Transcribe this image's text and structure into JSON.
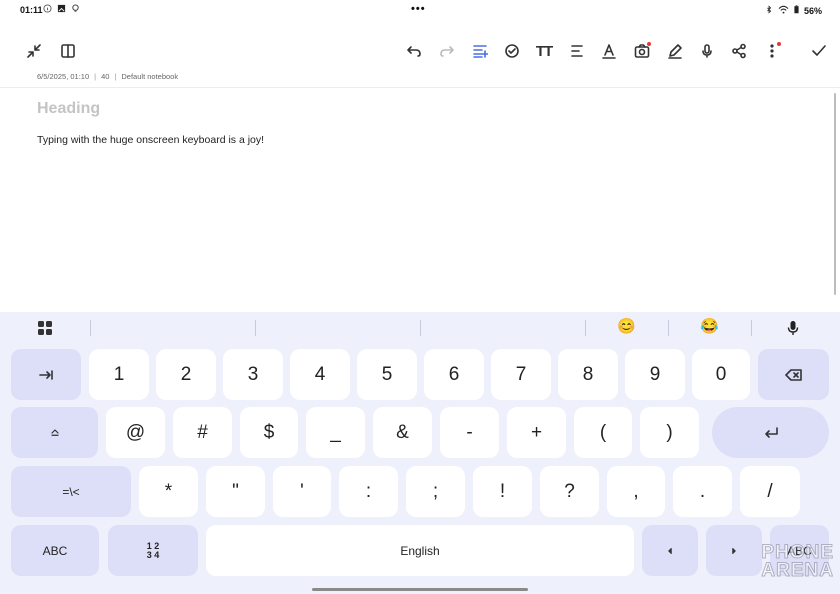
{
  "status_bar": {
    "time": "01:11",
    "left_icons": [
      "info-icon",
      "photo-icon",
      "bulb-icon"
    ],
    "center_dots": "•••",
    "right_icons": [
      "bluetooth-icon",
      "wifi-icon"
    ],
    "battery": "56%"
  },
  "toolbar": {
    "left": [
      "collapse-icon",
      "split-view-icon"
    ],
    "right": [
      "undo-icon",
      "redo-icon",
      "format-list-icon",
      "checkbox-icon",
      "text-size-icon",
      "align-icon",
      "text-color-icon",
      "camera-icon",
      "pen-icon",
      "voice-record-icon",
      "share-icon",
      "more-icon",
      "done-icon"
    ],
    "text_size_label": "TT",
    "red_badge_color": "#e53935"
  },
  "note": {
    "date": "6/5/2025, 01:10",
    "char_count": "40",
    "notebook": "Default notebook",
    "separator": "|",
    "heading_placeholder": "Heading",
    "body": "Typing with the huge onscreen keyboard is a joy!"
  },
  "keyboard": {
    "suggestions": [
      "",
      "",
      "",
      ""
    ],
    "emojis": [
      "😊",
      "😂"
    ],
    "row1": [
      "1",
      "2",
      "3",
      "4",
      "5",
      "6",
      "7",
      "8",
      "9",
      "0"
    ],
    "row2": [
      "@",
      "#",
      "$",
      "_",
      "&",
      "-",
      "+",
      "(",
      ")"
    ],
    "row3": [
      "*",
      "\"",
      "'",
      ":",
      ";",
      "!",
      "?",
      ",",
      ".",
      "/"
    ],
    "shift_label": "=\\<",
    "abc_left": "ABC",
    "num_top": "1 2",
    "num_bottom": "3 4",
    "space_label": "English",
    "abc_right": "ABC",
    "accent_color": "#dcdff7",
    "key_color": "#ffffff"
  },
  "watermark": {
    "line1": "PHONE",
    "line2": "ARENA"
  }
}
